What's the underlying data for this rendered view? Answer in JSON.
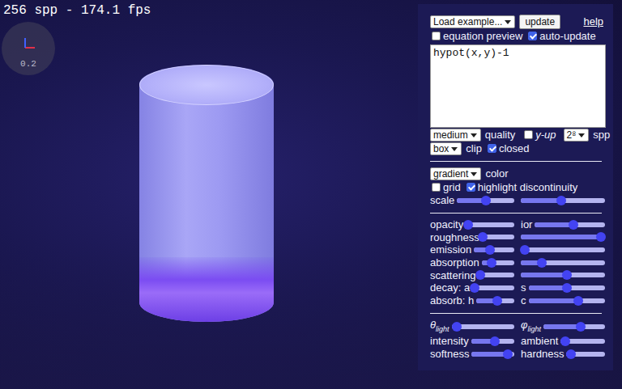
{
  "hud": {
    "stats": "256 spp - 174.1 fps",
    "axis_scale": "0.2"
  },
  "panel": {
    "example_select": "Load example...",
    "update_button": "update",
    "help_link": "help",
    "options": [
      {
        "label": "equation preview",
        "checked": false
      },
      {
        "label": "auto-update",
        "checked": true
      }
    ],
    "equation": "hypot(x,y)-1",
    "quality_select": "medium",
    "quality_label": "quality",
    "yup": {
      "label": "y-up",
      "checked": false
    },
    "spp_select": "2⁸",
    "spp_label": "spp",
    "clip_select": "box",
    "clip_label": "clip",
    "closed": {
      "label": "closed",
      "checked": true
    },
    "color_select": "gradient",
    "color_label": "color",
    "display_checks": [
      {
        "label": "grid",
        "checked": false
      },
      {
        "label": "highlight discontinuity",
        "checked": true
      }
    ],
    "scale_row": [
      {
        "label": "scale",
        "level": 0.5
      },
      {
        "level": 0.48
      }
    ],
    "material_rows": [
      [
        {
          "label": "opacity",
          "level": 0.05
        },
        {
          "label": "ior",
          "level": 0.55
        }
      ],
      [
        {
          "label": "roughness",
          "level": 0.02
        },
        {
          "level": 0.95
        }
      ],
      [
        {
          "label": "emission",
          "level": 0.4
        },
        {
          "level": 0.05
        }
      ],
      [
        {
          "label": "absorption",
          "level": 0.3
        },
        {
          "level": 0.25
        }
      ],
      [
        {
          "label": "scattering",
          "level": 0.05
        },
        {
          "level": 0.55
        }
      ],
      [
        {
          "label": "decay: a",
          "level": 0.05
        },
        {
          "label": "s",
          "level": 0.5
        }
      ],
      [
        {
          "label": "absorb: h",
          "level": 0.55
        },
        {
          "label": "c",
          "level": 0.65
        }
      ]
    ],
    "light_rows": [
      [
        {
          "label": "θ",
          "sub": "light",
          "level": 0.08
        },
        {
          "label": "φ",
          "sub": "light",
          "level": 0.6
        }
      ],
      [
        {
          "label": "intensity",
          "level": 0.55
        },
        {
          "label": "ambient",
          "level": 0.1
        }
      ],
      [
        {
          "label": "softness",
          "level": 0.85
        },
        {
          "label": "hardness",
          "level": 0.12
        }
      ]
    ]
  }
}
